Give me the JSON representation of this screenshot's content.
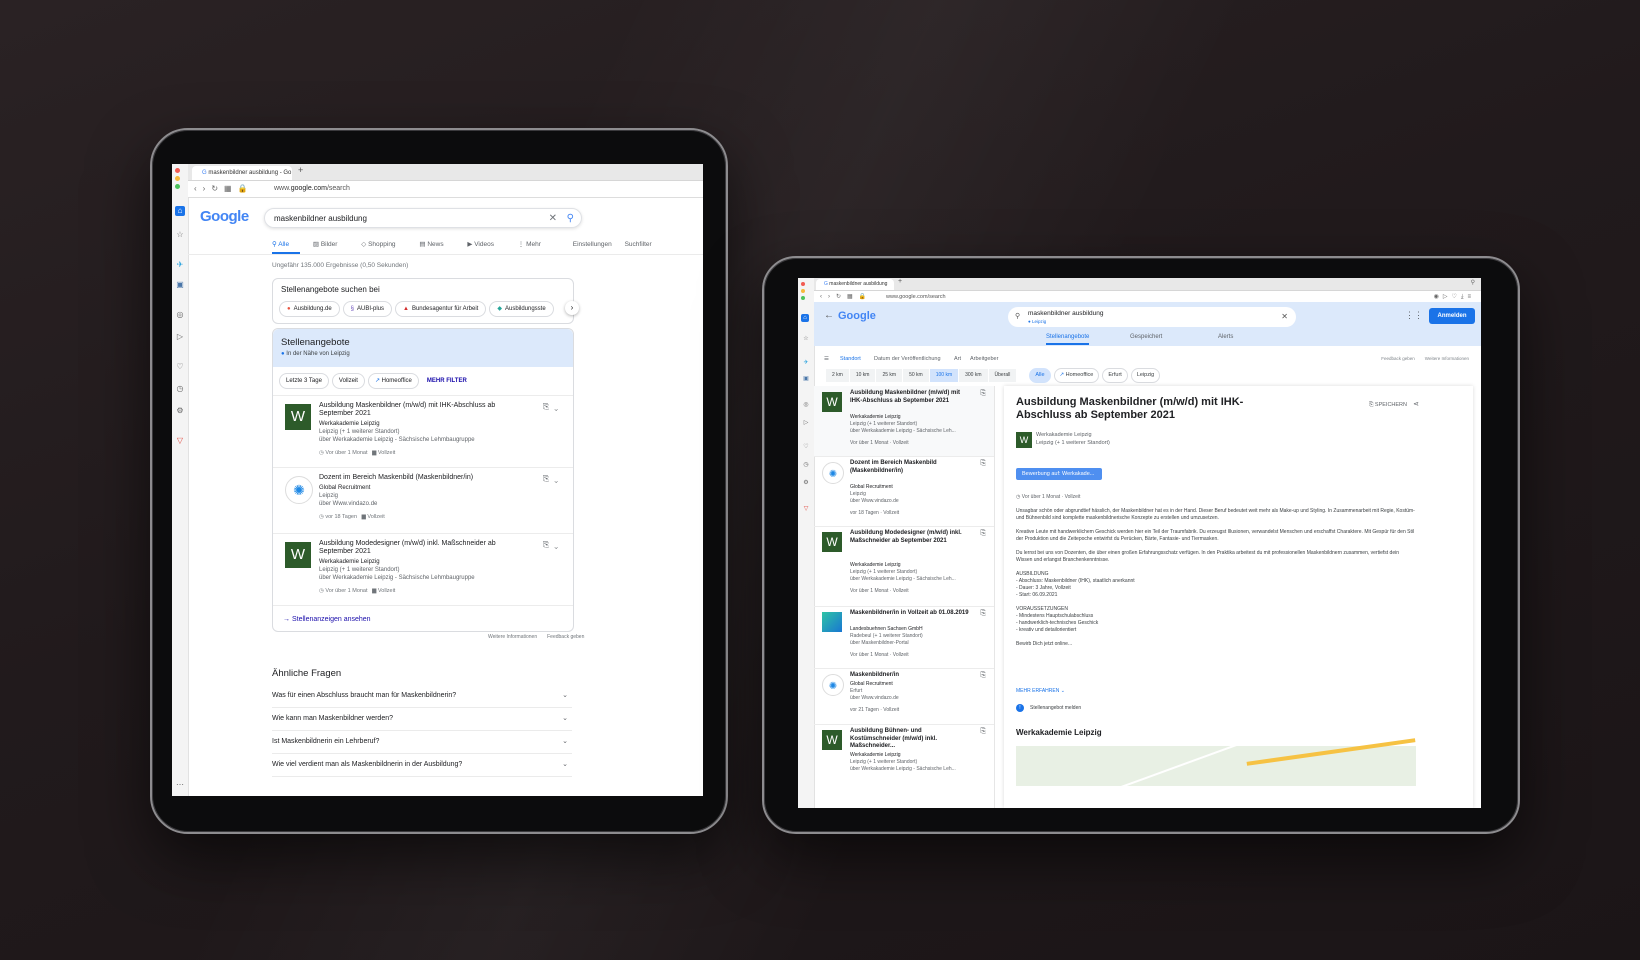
{
  "left": {
    "tab_title": "maskenbildner ausbildung - Go",
    "url_prefix": "www.",
    "url_domain": "google.com",
    "url_path": "/search",
    "logo": "Google",
    "query": "maskenbildner ausbildung",
    "nav_tabs": [
      "Alle",
      "Bilder",
      "Shopping",
      "News",
      "Videos",
      "Mehr",
      "Einstellungen",
      "Suchfilter"
    ],
    "result_stats": "Ungefähr 135.000 Ergebnisse (0,50 Sekunden)",
    "search_on": {
      "title": "Stellenangebote suchen bei",
      "chips": [
        "Ausbildung.de",
        "AUBI-plus",
        "Bundesagentur für Arbeit",
        "Ausbildungsste"
      ]
    },
    "jobs_box": {
      "title": "Stellenangebote",
      "subtitle": "In der Nähe von Leipzig",
      "filters": [
        "Letzte 3 Tage",
        "Vollzeit",
        "Homeoffice"
      ],
      "more_filters": "MEHR FILTER",
      "jobs": [
        {
          "logo_text": "W",
          "title": "Ausbildung Maskenbildner (m/w/d) mit IHK-Abschluss ab September 2021",
          "company": "Werkakademie Leipzig",
          "location": "Leipzig (+ 1 weiterer Standort)",
          "via": "über Werkakademie Leipzig - Sächsische Lehmbaugruppe",
          "age": "Vor über 1 Monat",
          "type": "Vollzeit"
        },
        {
          "logo_text": "",
          "title": "Dozent im Bereich Maskenbild (Maskenbildner/in)",
          "company": "Global Recruitment",
          "location": "Leipzig",
          "via": "über Www.vindazo.de",
          "age": "vor 18 Tagen",
          "type": "Vollzeit"
        },
        {
          "logo_text": "W",
          "title": "Ausbildung Modedesigner (m/w/d) inkl. Maßschneider ab September 2021",
          "company": "Werkakademie Leipzig",
          "location": "Leipzig (+ 1 weiterer Standort)",
          "via": "über Werkakademie Leipzig - Sächsische Lehmbaugruppe",
          "age": "Vor über 1 Monat",
          "type": "Vollzeit"
        }
      ],
      "see_all": "Stellenanzeigen ansehen"
    },
    "feedback": [
      "Weitere Informationen",
      "Feedback geben"
    ],
    "paa": {
      "title": "Ähnliche Fragen",
      "questions": [
        "Was für einen Abschluss braucht man für Maskenbildnerin?",
        "Wie kann man Maskenbildner werden?",
        "Ist Maskenbildnerin ein Lehrberuf?",
        "Wie viel verdient man als Maskenbildnerin in der Ausbildung?"
      ]
    }
  },
  "right": {
    "tab_title": "maskenbildner ausbildung",
    "url": "www.google.com/search",
    "logo": "Google",
    "query": "maskenbildner ausbildung",
    "location_chip": "Leipzig",
    "signin": "Anmelden",
    "tabs": [
      "Stellenangebote",
      "Gespeichert",
      "Alerts"
    ],
    "filters": [
      "Standort",
      "Datum der Veröffentlichung",
      "Art",
      "Arbeitgeber"
    ],
    "feedback": [
      "Feedback geben",
      "Weitere Informationen"
    ],
    "distances": [
      "2 km",
      "10 km",
      "25 km",
      "50 km",
      "100 km",
      "300 km",
      "Überall"
    ],
    "chips": [
      "Alle",
      "Homeoffice",
      "Erfurt",
      "Leipzig"
    ],
    "jobs": [
      {
        "logo_text": "W",
        "title": "Ausbildung Maskenbildner (m/w/d) mit IHK-Abschluss ab September 2021",
        "company": "Werkakademie Leipzig",
        "location": "Leipzig (+ 1 weiterer Standort)",
        "via": "über Werkakademie Leipzig - Sächsische Leh...",
        "meta": "Vor über 1 Monat · Vollzeit"
      },
      {
        "logo_text": "",
        "title": "Dozent im Bereich Maskenbild (Maskenbildner/in)",
        "company": "Global Recruitment",
        "location": "Leipzig",
        "via": "über Www.vindazo.de",
        "meta": "vor 18 Tagen · Vollzeit"
      },
      {
        "logo_text": "W",
        "title": "Ausbildung Modedesigner (m/w/d) inkl. Maßschneider ab September 2021",
        "company": "Werkakademie Leipzig",
        "location": "Leipzig (+ 1 weiterer Standort)",
        "via": "über Werkakademie Leipzig - Sächsische Leh...",
        "meta": "Vor über 1 Monat · Vollzeit"
      },
      {
        "logo_text": "",
        "title": "Maskenbildner/in in Vollzeit ab 01.08.2019",
        "company": "Landesbuehnen Sachsen GmbH",
        "location": "Radebeul (+ 1 weiterer Standort)",
        "via": "über Maskenbildner-Portal",
        "meta": "Vor über 1 Monat · Vollzeit"
      },
      {
        "logo_text": "",
        "title": "Maskenbildner/in",
        "company": "Global Recruitment",
        "location": "Erfurt",
        "via": "über Www.vindazo.de",
        "meta": "vor 21 Tagen · Vollzeit"
      },
      {
        "logo_text": "W",
        "title": "Ausbildung Bühnen- und Kostümschneider (m/w/d) inkl. Maßschneider...",
        "company": "Werkakademie Leipzig",
        "location": "Leipzig (+ 1 weiterer Standort)",
        "via": "über Werkakademie Leipzig - Sächsische Leh...",
        "meta": ""
      }
    ],
    "detail": {
      "title": "Ausbildung Maskenbildner (m/w/d) mit IHK-Abschluss ab September 2021",
      "save": "SPEICHERN",
      "company": "Werkakademie Leipzig",
      "location": "Leipzig (+ 1 weiterer Standort)",
      "apply": "Bewerbung auf: Werkakade...",
      "meta": "Vor über 1 Monat · Vollzeit",
      "description": "Unsagbar schön oder abgrundtief hässlich, der Maskenbildner hat es in der Hand. Dieser Beruf bedeutet weit mehr als Make-up und Styling. In Zusammenarbeit mit Regie, Kostüm- und Bühnenbild sind komplette maskenbildnerische Konzepte zu erstellen und umzusetzen.\n\nKreative Leute mit handwerklichem Geschick werden hier ein Teil der Traumfabrik. Du erzeugst Illusionen, verwandelst Menschen und erschaffst Charaktere. Mit Gespür für den Stil der Produktion und die Zeitepoche entwirfst du Perücken, Bärte, Fantasie- und Tiermasken.\n\nDu lernst bei uns von Dozenten, die über einen großen Erfahrungsschatz verfügen. In den Praktika arbeitest du mit professionellen Maskenbildnern zusammen, vertiefst dein Wissen und erlangst Branchenkenntnisse.\n\nAUSBILDUNG\n- Abschluss: Maskenbildner (IHK), staatlich anerkannt\n- Dauer: 3 Jahre, Vollzeit\n- Start: 06.09.2021\n\nVORAUSSETZUNGEN\n- Mindestens Hauptschulabschluss\n- handwerklich-technisches Geschick\n- kreativ und detailorientiert\n\nBewirb Dich jetzt online...",
      "more": "MEHR ERFAHREN",
      "report": "Stellenangebot melden",
      "company_heading": "Werkakademie Leipzig"
    }
  }
}
